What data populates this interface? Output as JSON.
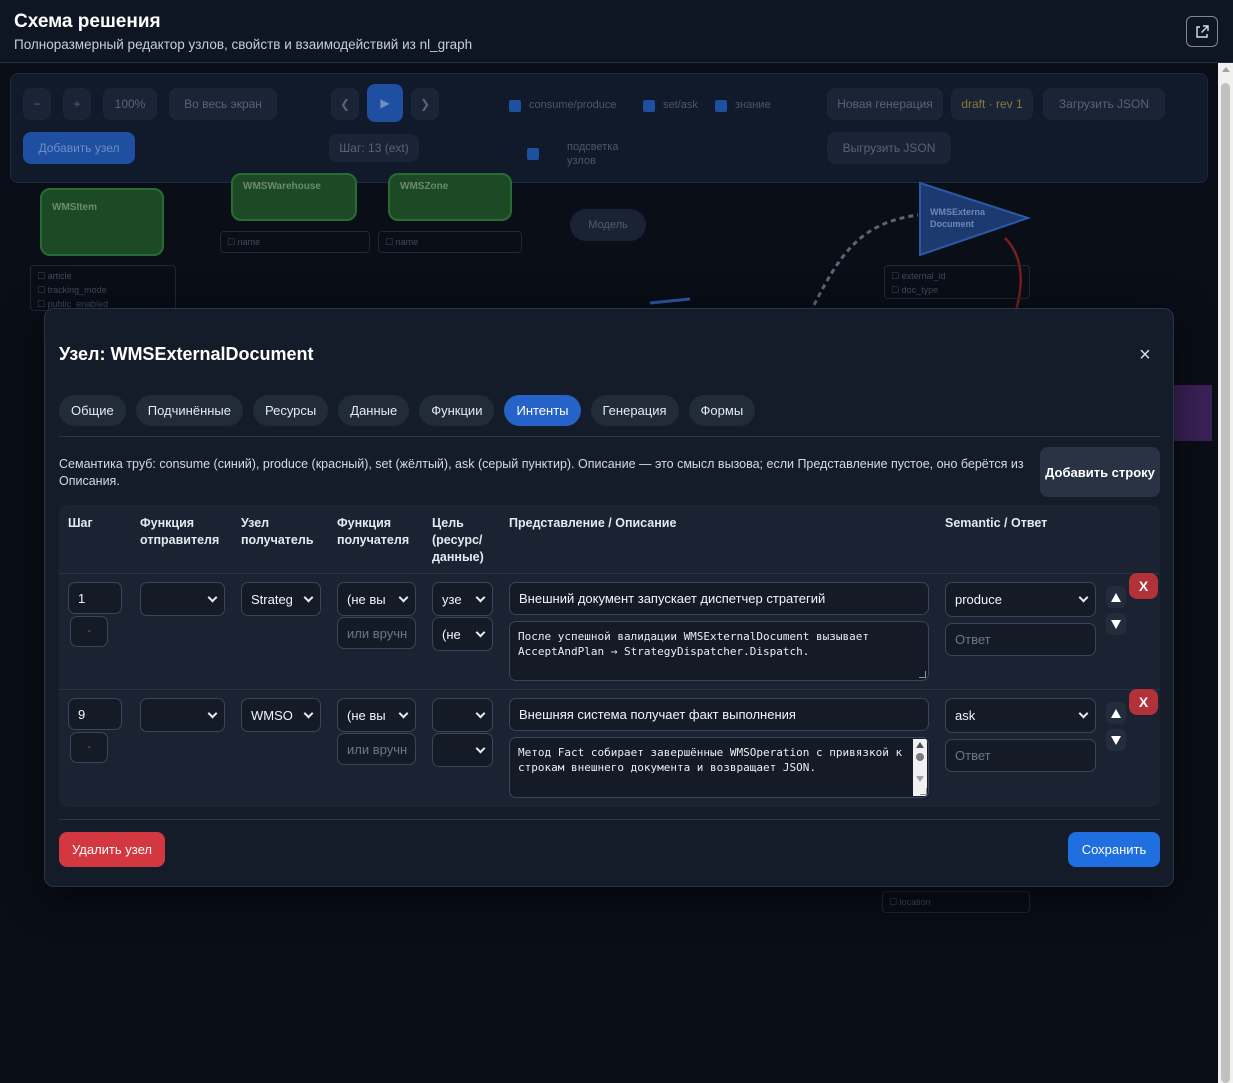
{
  "header": {
    "title": "Схема решения",
    "subtitle": "Полноразмерный редактор узлов, свойств и взаимодействий из nl_graph"
  },
  "background": {
    "toolbar": {
      "zoom_out": "−",
      "zoom_in": "+",
      "zoom_level": "100%",
      "fullscreen": "Во весь экран",
      "prev": "❮",
      "play": "▶",
      "next": "❯",
      "check_consume_produce": "consume/produce",
      "check_set_ask": "set/ask",
      "check_knowledge": "знание",
      "new_generation": "Новая генерация",
      "draft": "draft · rev 1",
      "load_json": "Загрузить JSON",
      "add_node": "Добавить узел",
      "step": "Шаг: 13 (ext)",
      "highlight_nodes": "подсветка узлов",
      "export_json": "Выгрузить JSON"
    },
    "nodes": {
      "wms_item": "WMSItem",
      "wms_warehouse": "WMSWarehouse",
      "wms_zone": "WMSZone",
      "model": "Модель",
      "wms_external_document": "WMSExterna Document",
      "item_props": [
        "☐ article",
        "☐ tracking_mode",
        "☐ public_enabled"
      ],
      "warehouse_props": [
        "☐ name"
      ],
      "zone_props": [
        "☐ name"
      ],
      "doc_props": [
        "☐ external_id",
        "☐ doc_type"
      ],
      "location_props": [
        "☐ location"
      ]
    }
  },
  "modal": {
    "title": "Узел: WMSExternalDocument",
    "close": "×",
    "tabs": [
      {
        "label": "Общие",
        "active": false
      },
      {
        "label": "Подчинённые",
        "active": false
      },
      {
        "label": "Ресурсы",
        "active": false
      },
      {
        "label": "Данные",
        "active": false
      },
      {
        "label": "Функции",
        "active": false
      },
      {
        "label": "Интенты",
        "active": true
      },
      {
        "label": "Генерация",
        "active": false
      },
      {
        "label": "Формы",
        "active": false
      }
    ],
    "hint": "Семантика труб: consume (синий), produce (красный), set (жёлтый), ask (серый пунктир). Описание — это смысл вызова; если Представление пустое, оно берётся из Описания.",
    "add_row": "Добавить строку",
    "columns": {
      "step": "Шаг",
      "sender_function": "Функция отправителя",
      "receiver_node": "Узел получатель",
      "receiver_function": "Функция получателя",
      "target": "Цель (ресурс/ данные)",
      "representation": "Представление / Описание",
      "semantic": "Semantic / Ответ"
    },
    "rows": [
      {
        "step": "1",
        "substep": "-",
        "sender_function": "",
        "receiver_node": "Strateg",
        "receiver_function": "(не вы",
        "receiver_function_manual_placeholder": "или вручн",
        "target": "узе",
        "target_data": "(не",
        "representation": "Внешний документ запускает диспетчер стратегий",
        "description": "После успешной валидации WMSExternalDocument вызывает AcceptAndPlan → StrategyDispatcher.Dispatch.",
        "semantic": "produce",
        "answer_placeholder": "Ответ",
        "move_up": "▲",
        "move_down": "▼",
        "delete": "X"
      },
      {
        "step": "9",
        "substep": "-",
        "sender_function": "",
        "receiver_node": "WMSO",
        "receiver_function": "(не вы",
        "receiver_function_manual_placeholder": "или вручн",
        "target": "",
        "target_data": "",
        "representation": "Внешняя система получает факт выполнения",
        "description": "Метод Fact собирает завершённые WMSOperation с привязкой к строкам внешнего документа и возвращает JSON.",
        "semantic": "ask",
        "answer_placeholder": "Ответ",
        "move_up": "▲",
        "move_down": "▼",
        "delete": "X"
      }
    ],
    "delete_node": "Удалить узел",
    "save": "Сохранить"
  }
}
